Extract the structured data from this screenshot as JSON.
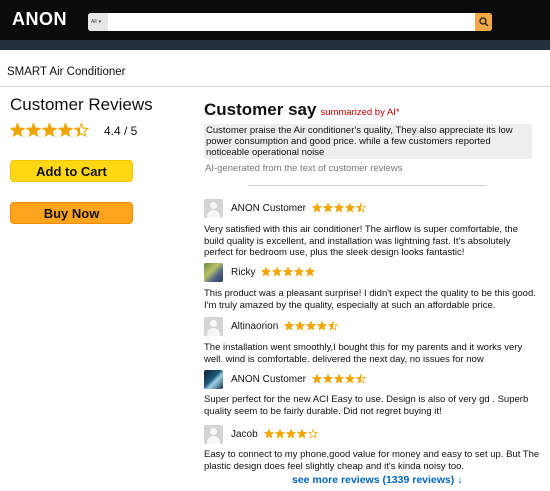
{
  "header": {
    "logo": "ANON",
    "search_category": "All",
    "search_placeholder": "",
    "brand_colors": {
      "bar": "#0b0b0b",
      "sub_bar": "#22303d",
      "search_button": "#f3a847"
    }
  },
  "breadcrumb": "SMART Air Conditioner",
  "left": {
    "title": "Customer Reviews",
    "rating_text": "4.4 / 5",
    "rating_value": 4.4,
    "add_to_cart": "Add to Cart",
    "buy_now": "Buy Now"
  },
  "summary": {
    "title": "Customer say",
    "subtitle": "summarized by AI*",
    "text": "Customer praise the Air conditioner's quality, They also appreciate its low power consumption and good price. while a few customers reported noticeable operational noise",
    "note": "AI-generated from the text of customer reviews"
  },
  "reviews": [
    {
      "name": "ANON Customer",
      "rating": 4.5,
      "avatar": "default-avatar-icon",
      "text": "Very satisfied with this air conditioner! The airflow is super comfortable, the build quality is excellent, and installation was lightning fast. It's absolutely perfect for bedroom use, plus the sleek design looks fantastic!"
    },
    {
      "name": "Ricky",
      "rating": 5,
      "avatar": "photo-avatar",
      "text": "This product was a pleasant surprise! I didn't expect the  quality to be this good. I'm truly amazed by the quality, especially at such an affordable price."
    },
    {
      "name": "Altinaorion",
      "rating": 4.5,
      "avatar": "default-avatar-icon",
      "text": "The installation went smoothly,I bought this for my parents and it works very well. wind is comfortable. delivered the next day, no issues for now"
    },
    {
      "name": "ANON Customer",
      "rating": 4.5,
      "avatar": "photo-avatar",
      "text": "Super perfect for the new ACI Easy to use. Design is also of very gd . Superb quality seem to be fairly durable. Did not regret buying it!"
    },
    {
      "name": "Jacob",
      "rating": 4,
      "avatar": "default-avatar-icon",
      "text": "Easy to connect to my phone,good value for money and easy to set up. But The plastic design does feel slightly cheap and it's kinda noisy too."
    }
  ],
  "see_more": "see more reviews (1339 reviews) ↓",
  "colors": {
    "star": "#f0a500",
    "link": "#0066c0",
    "cart": "#ffd814",
    "buy": "#ffa41c",
    "ai_red": "#c40000"
  }
}
